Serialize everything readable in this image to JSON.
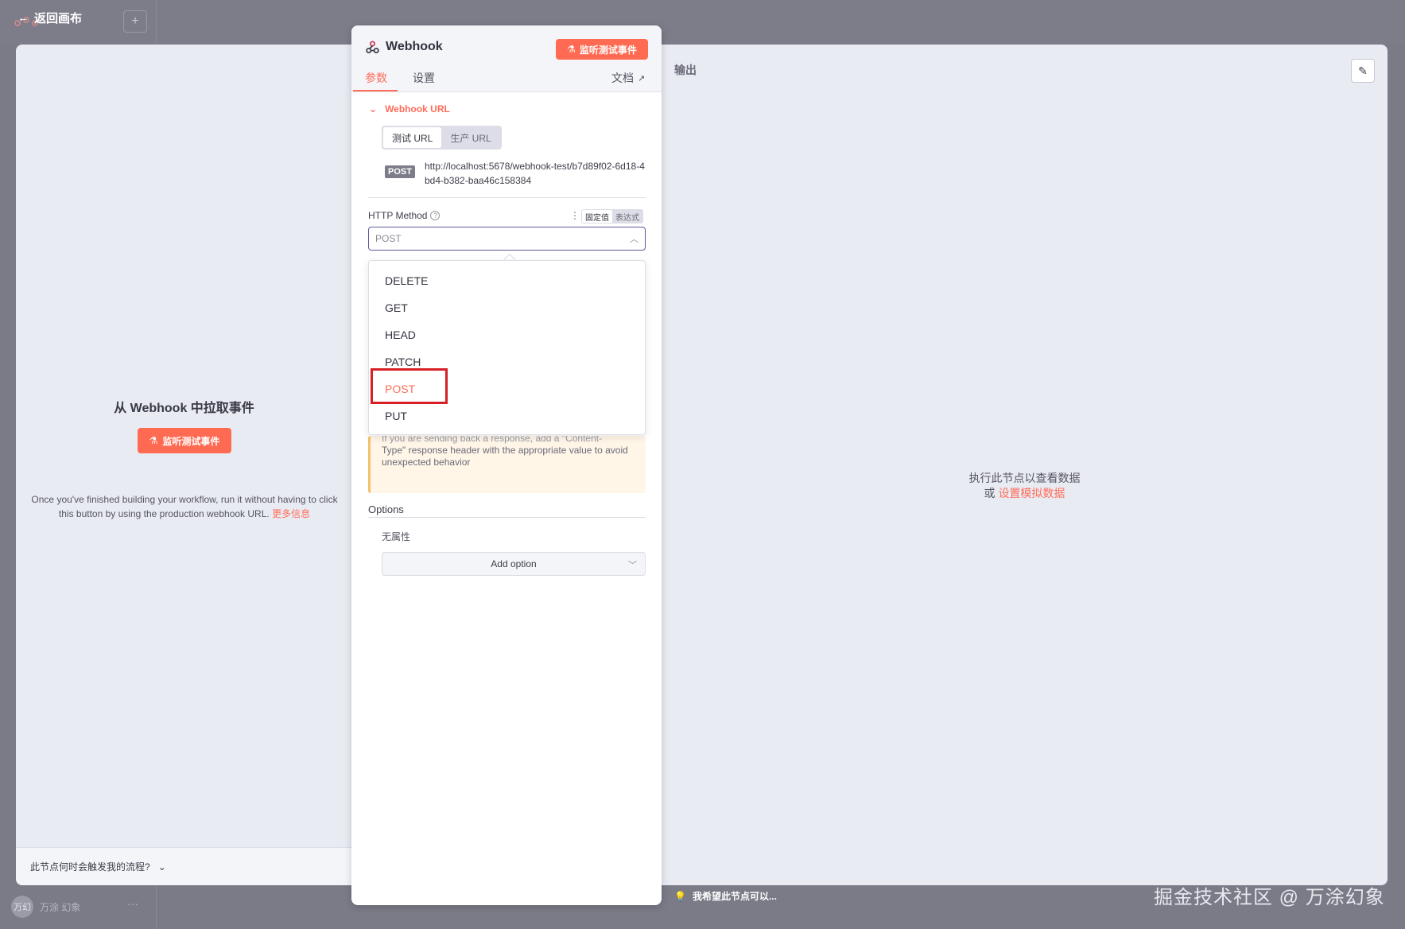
{
  "topbar": {
    "back_label": "返回画布",
    "back_icon": "arrow-left-icon",
    "plus_label": "+"
  },
  "sidebar": {
    "user_name": "万涂 幻象",
    "avatar_text": "万幻",
    "more_label": "···"
  },
  "left": {
    "title": "从 Webhook 中拉取事件",
    "listen_button": "监听测试事件",
    "description": "Once you've finished building your workflow, run it without having to click this button by using the production webhook URL.",
    "more_info": "更多信息",
    "footer_question": "此节点何时会触发我的流程?"
  },
  "panel": {
    "title": "Webhook",
    "listen_button": "监听测试事件",
    "tabs": [
      {
        "label": "参数"
      },
      {
        "label": "设置"
      }
    ],
    "docs_label": "文档",
    "webhook_url_section": "Webhook URL",
    "url_toggle": [
      {
        "label": "测试 URL"
      },
      {
        "label": "生产 URL"
      }
    ],
    "method_badge": "POST",
    "url": "http://localhost:5678/webhook-test/b7d89f02-6d18-4bd4-b382-baa46c158384",
    "http_method_label": "HTTP Method",
    "mode_toggle": [
      {
        "label": "固定值"
      },
      {
        "label": "表达式"
      }
    ],
    "select_value": "POST",
    "dropdown_options": [
      {
        "label": "DELETE"
      },
      {
        "label": "GET"
      },
      {
        "label": "HEAD"
      },
      {
        "label": "PATCH"
      },
      {
        "label": "POST"
      },
      {
        "label": "PUT"
      }
    ],
    "notice_cut": "If you are sending back a response, add a \"Content-",
    "notice_text": "Type\" response header with the appropriate value to avoid unexpected behavior",
    "options_label": "Options",
    "no_properties": "无属性",
    "add_option": "Add option"
  },
  "right": {
    "output_title": "输出",
    "empty_line1": "执行此节点以查看数据",
    "empty_prefix": "或",
    "mock_link": "设置模拟数据"
  },
  "hint_bar": {
    "text": "我希望此节点可以..."
  },
  "watermark": "掘金技术社区 @ 万涂幻象",
  "colors": {
    "accent": "#ff6d5a",
    "highlight": "#d62024"
  }
}
